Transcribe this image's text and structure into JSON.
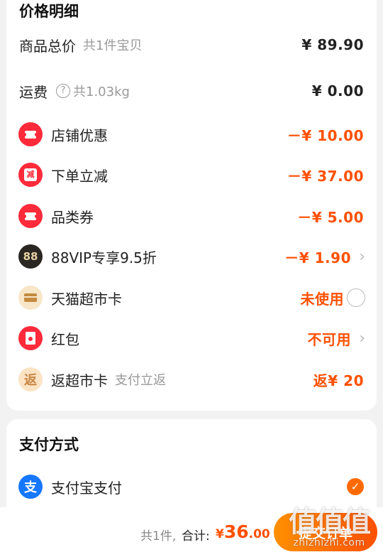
{
  "price_details": {
    "title": "价格明细",
    "goods_total": {
      "label": "商品总价",
      "sub": "共1件宝贝",
      "amount": "¥ 89.90"
    },
    "shipping": {
      "label": "运费",
      "help": "?",
      "sub": "共1.03kg",
      "amount": "¥ 0.00"
    },
    "discounts": [
      {
        "label": "店铺优惠",
        "amount": "－¥ 10.00",
        "icon": "coupon-icon"
      },
      {
        "label": "下单立减",
        "amount": "－¥ 37.00",
        "icon": "instant-discount-icon",
        "icon_text": "减"
      },
      {
        "label": "品类券",
        "amount": "－¥ 5.00",
        "icon": "coupon-icon"
      },
      {
        "label": "88VIP专享9.5折",
        "amount": "－¥ 1.90",
        "icon": "vip88-icon",
        "icon_text": "88"
      },
      {
        "label": "天猫超市卡",
        "amount": "未使用",
        "icon": "supermarket-card-icon"
      },
      {
        "label": "红包",
        "amount": "不可用",
        "icon": "red-packet-icon"
      },
      {
        "label": "返超市卡",
        "sub": "支付立返",
        "amount": "返¥ 20",
        "icon": "cashback-icon",
        "icon_text": "返"
      }
    ]
  },
  "payment": {
    "title": "支付方式",
    "method": {
      "label": "支付宝支付",
      "icon": "alipay-icon",
      "icon_text": "支",
      "selected": true,
      "check": "✓"
    }
  },
  "footer": {
    "count": "共1件,",
    "total_label": "合计:",
    "total_currency": "¥",
    "total_int": "36",
    "total_dec": ".00",
    "submit_label": "提交订单"
  },
  "watermark": {
    "main": "值值值",
    "sub": "zhizhizhi.com"
  },
  "colors": {
    "accent": "#ff5000",
    "red": "#ff2a3a",
    "alipay": "#1677ff"
  }
}
